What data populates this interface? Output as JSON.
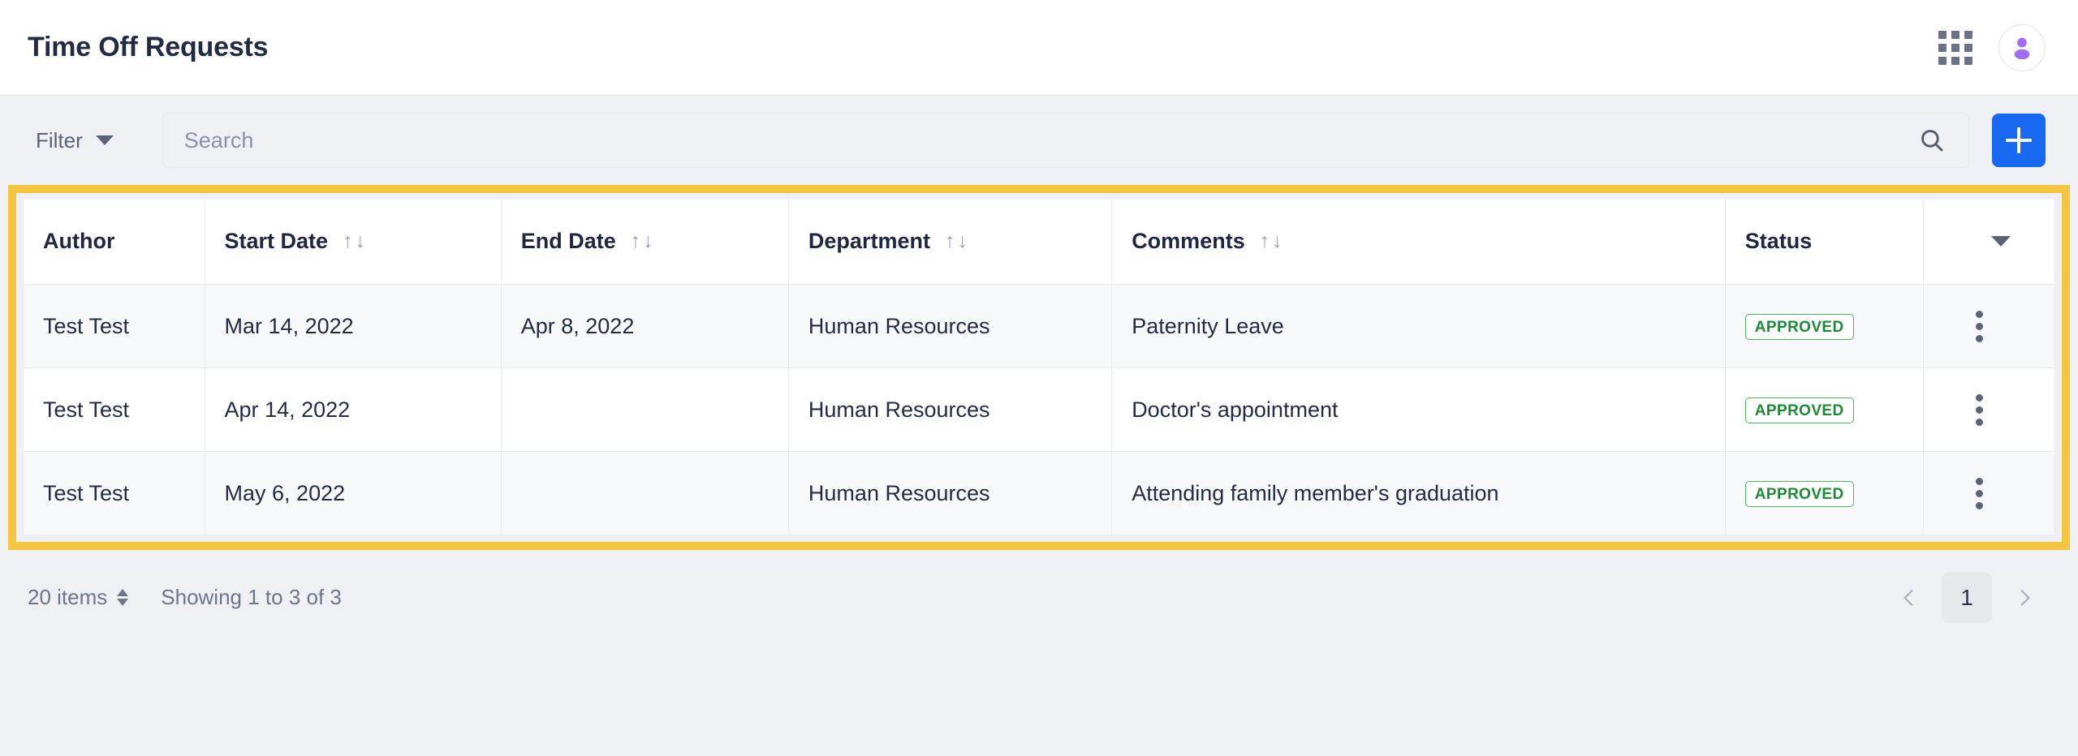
{
  "header": {
    "title": "Time Off Requests",
    "apps_grid_icon": "apps-grid-icon",
    "avatar_icon": "user-avatar-icon"
  },
  "toolbar": {
    "filter_label": "Filter",
    "filter_caret_icon": "chevron-down-icon",
    "search_placeholder": "Search",
    "search_value": "",
    "search_icon": "search-icon",
    "add_label": "+",
    "add_icon": "plus-icon"
  },
  "table": {
    "highlight_color": "#f3c63f",
    "columns": [
      {
        "label": "Author",
        "sortable": false
      },
      {
        "label": "Start Date",
        "sortable": true
      },
      {
        "label": "End Date",
        "sortable": true
      },
      {
        "label": "Department",
        "sortable": true
      },
      {
        "label": "Comments",
        "sortable": true
      },
      {
        "label": "Status",
        "sortable": false
      },
      {
        "label": "",
        "sortable": false
      }
    ],
    "sort_asc_glyph": "↑",
    "sort_desc_glyph": "↓",
    "column_menu_icon": "chevron-down-icon",
    "row_menu_icon": "kebab-menu-icon",
    "rows": [
      {
        "author": "Test Test",
        "start_date": "Mar 14, 2022",
        "end_date": "Apr 8, 2022",
        "department": "Human Resources",
        "comments": "Paternity Leave",
        "status": "APPROVED"
      },
      {
        "author": "Test Test",
        "start_date": "Apr 14, 2022",
        "end_date": "",
        "department": "Human Resources",
        "comments": "Doctor's appointment",
        "status": "APPROVED"
      },
      {
        "author": "Test Test",
        "start_date": "May 6, 2022",
        "end_date": "",
        "department": "Human Resources",
        "comments": "Attending family member's graduation",
        "status": "APPROVED"
      }
    ]
  },
  "footer": {
    "items_per_page": "20 items",
    "showing": "Showing 1 to 3 of 3",
    "prev_icon": "chevron-left-icon",
    "next_icon": "chevron-right-icon",
    "current_page": "1"
  },
  "colors": {
    "accent_blue": "#1868f2",
    "highlight_yellow": "#f3c63f",
    "status_green": "#1d8a36",
    "avatar_purple": "#a06bf5",
    "page_bg": "#eff0f4"
  }
}
